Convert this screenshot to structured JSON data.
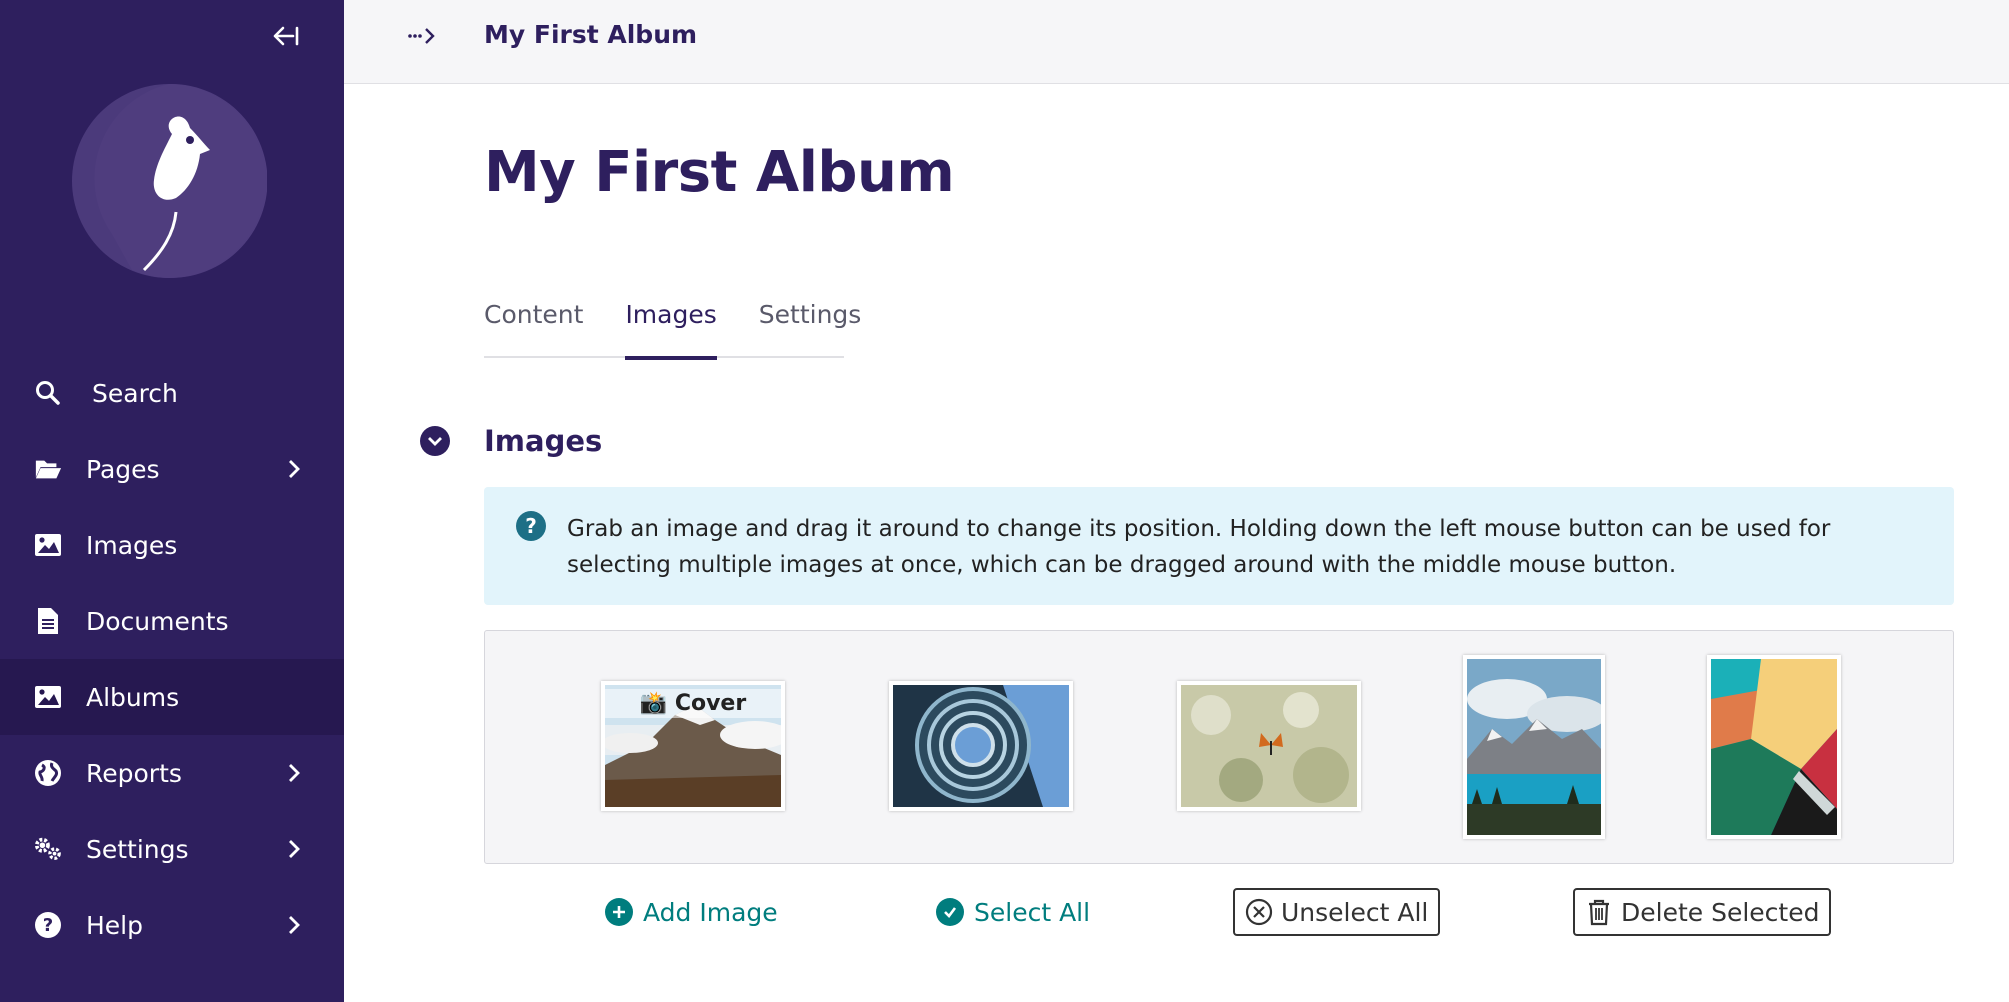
{
  "sidebar": {
    "collapse_icon": "collapse-left-icon",
    "logo_icon": "wagtail-bird-icon",
    "items": [
      {
        "label": "Search",
        "icon": "search-icon",
        "has_submenu": false,
        "active": false
      },
      {
        "label": "Pages",
        "icon": "folder-open-icon",
        "has_submenu": true,
        "active": false
      },
      {
        "label": "Images",
        "icon": "image-icon",
        "has_submenu": false,
        "active": false
      },
      {
        "label": "Documents",
        "icon": "document-icon",
        "has_submenu": false,
        "active": false
      },
      {
        "label": "Albums",
        "icon": "image-icon",
        "has_submenu": false,
        "active": true
      },
      {
        "label": "Reports",
        "icon": "globe-icon",
        "has_submenu": true,
        "active": false
      },
      {
        "label": "Settings",
        "icon": "cogs-icon",
        "has_submenu": true,
        "active": false
      },
      {
        "label": "Help",
        "icon": "help-icon",
        "has_submenu": true,
        "active": false
      }
    ]
  },
  "header": {
    "breadcrumb_toggle": "···>",
    "title": "My First Album"
  },
  "main": {
    "title": "My First Album",
    "tabs": [
      {
        "label": "Content",
        "active": false
      },
      {
        "label": "Images",
        "active": true
      },
      {
        "label": "Settings",
        "active": false
      }
    ],
    "section_title": "Images",
    "help_text": "Grab an image and drag it around to change its position. Holding down the left mouse button can be used for selecting multiple images at once, which can be dragged around with the middle mouse button.",
    "cover_label": "📸 Cover",
    "images": [
      {
        "name": "mountain",
        "cover": true
      },
      {
        "name": "spiral-building",
        "cover": false
      },
      {
        "name": "butterfly",
        "cover": false
      },
      {
        "name": "lake",
        "cover": false
      },
      {
        "name": "abstract",
        "cover": false
      }
    ],
    "actions": {
      "add_image": "Add Image",
      "select_all": "Select All",
      "unselect_all": "Unselect All",
      "delete_selected": "Delete Selected"
    }
  },
  "colors": {
    "sidebar": "#2e1f5e",
    "sidebar_active": "#261850",
    "accent": "#007d7e",
    "help_bg": "#e2f4fb"
  }
}
